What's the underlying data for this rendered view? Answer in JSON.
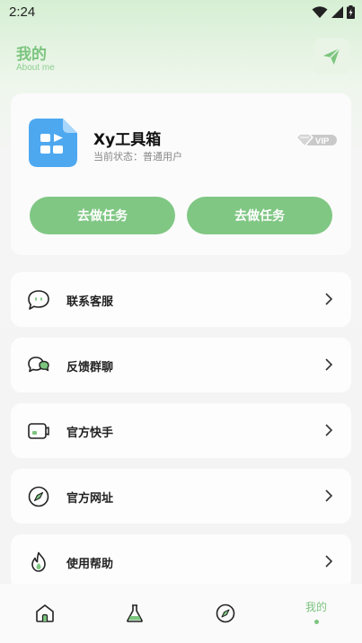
{
  "status_bar": {
    "time": "2:24"
  },
  "header": {
    "title": "我的",
    "subtitle": "About me"
  },
  "profile": {
    "app_name": "Xy工具箱",
    "status_text": "当前状态：普通用户",
    "vip_label": "VIP",
    "task_button_left": "去做任务",
    "task_button_right": "去做任务"
  },
  "menu": [
    {
      "label": "联系客服",
      "icon": "chat-bubble-icon"
    },
    {
      "label": "反馈群聊",
      "icon": "group-chat-icon"
    },
    {
      "label": "官方快手",
      "icon": "video-icon"
    },
    {
      "label": "官方网址",
      "icon": "compass-icon"
    },
    {
      "label": "使用帮助",
      "icon": "fire-icon"
    }
  ],
  "bottom_nav": {
    "items": [
      {
        "icon": "home-icon"
      },
      {
        "icon": "flask-icon"
      },
      {
        "icon": "compass-icon"
      },
      {
        "label": "我的",
        "active": true
      }
    ]
  },
  "colors": {
    "accent": "#80c784",
    "title_green": "#7cc57f",
    "app_icon_blue": "#4ea8f0"
  }
}
